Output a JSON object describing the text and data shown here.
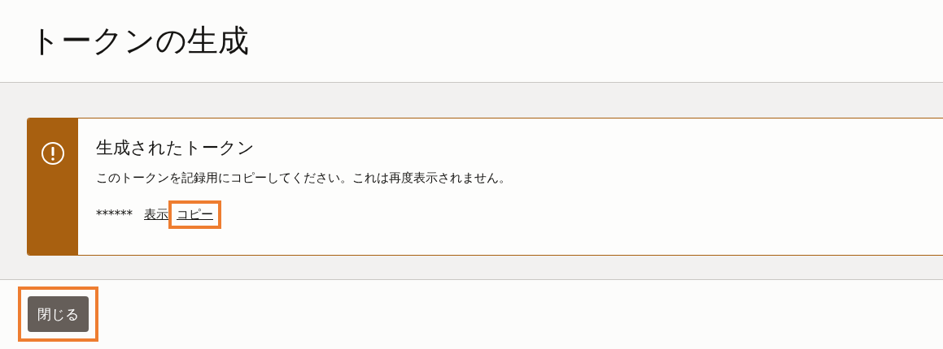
{
  "page": {
    "title": "トークンの生成"
  },
  "banner": {
    "kind": "warning",
    "title": "生成されたトークン",
    "message": "このトークンを記録用にコピーしてください。これは再度表示されません。",
    "masked_token": "******",
    "links": [
      {
        "label": "表示",
        "highlighted": false
      },
      {
        "label": "コピー",
        "highlighted": true
      }
    ]
  },
  "footer": {
    "buttons": [
      {
        "label": "閉じる",
        "highlighted": true
      }
    ]
  }
}
